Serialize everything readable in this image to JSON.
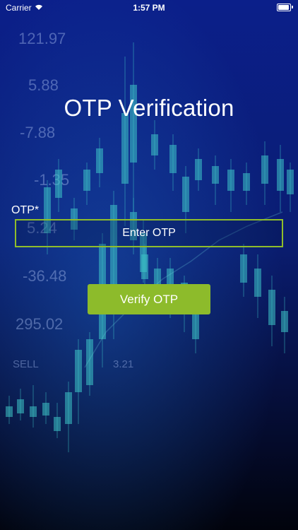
{
  "status_bar": {
    "carrier": "Carrier",
    "time": "1:57 PM"
  },
  "screen": {
    "title": "OTP Verification",
    "otp_label": "OTP*",
    "otp_placeholder": "Enter OTP",
    "verify_label": "Verify OTP"
  },
  "background": {
    "numbers": [
      "121.97",
      "5.88",
      "-7.88",
      "-1.35",
      "5.24",
      "-36.48",
      "295.02",
      "SELL",
      "3.21"
    ],
    "colors": {
      "top": "#0b1f8a",
      "mid": "#081652",
      "bottom": "#01030c",
      "candle": "#3ec6c8"
    }
  },
  "colors": {
    "accent": "#8dbb2b",
    "text": "#ffffff"
  }
}
